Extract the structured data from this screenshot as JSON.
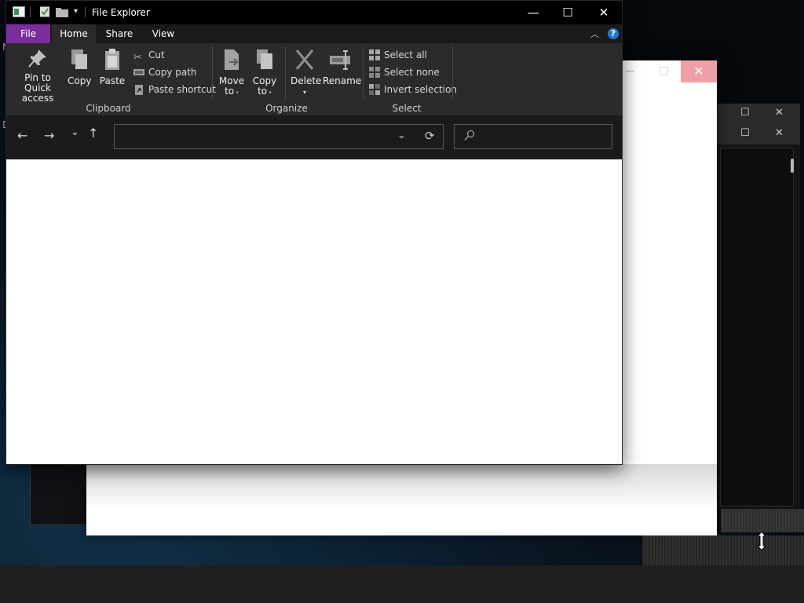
{
  "window": {
    "title": "File Explorer",
    "controls": {
      "minimize": "—",
      "maximize": "☐",
      "close": "✕"
    }
  },
  "desktop": {
    "edge_letters": [
      "N",
      "D"
    ]
  },
  "tabs": {
    "file": "File",
    "home": "Home",
    "share": "Share",
    "view": "View"
  },
  "ribbon": {
    "clipboard": {
      "pin_label_line1": "Pin to Quick",
      "pin_label_line2": "access",
      "copy_label": "Copy",
      "paste_label": "Paste",
      "cut_label": "Cut",
      "copy_path_label": "Copy path",
      "paste_shortcut_label": "Paste shortcut",
      "group_label": "Clipboard"
    },
    "organize": {
      "move_line1": "Move",
      "move_line2": "to",
      "copyto_line1": "Copy",
      "copyto_line2": "to",
      "delete_label": "Delete",
      "rename_label": "Rename",
      "group_label": "Organize"
    },
    "select": {
      "select_all_label": "Select all",
      "select_none_label": "Select none",
      "invert_label": "Invert selection",
      "group_label": "Select"
    }
  },
  "navigation": {
    "back": "←",
    "forward": "→",
    "recent": "⌄",
    "up": "↑",
    "address_value": "",
    "search_placeholder": ""
  },
  "colors": {
    "file_tab_accent": "#7a2e9e",
    "help_icon": "#1f7ad6",
    "ribbon_bg": "#2b2b2b",
    "titlebar_bg": "#000000"
  }
}
